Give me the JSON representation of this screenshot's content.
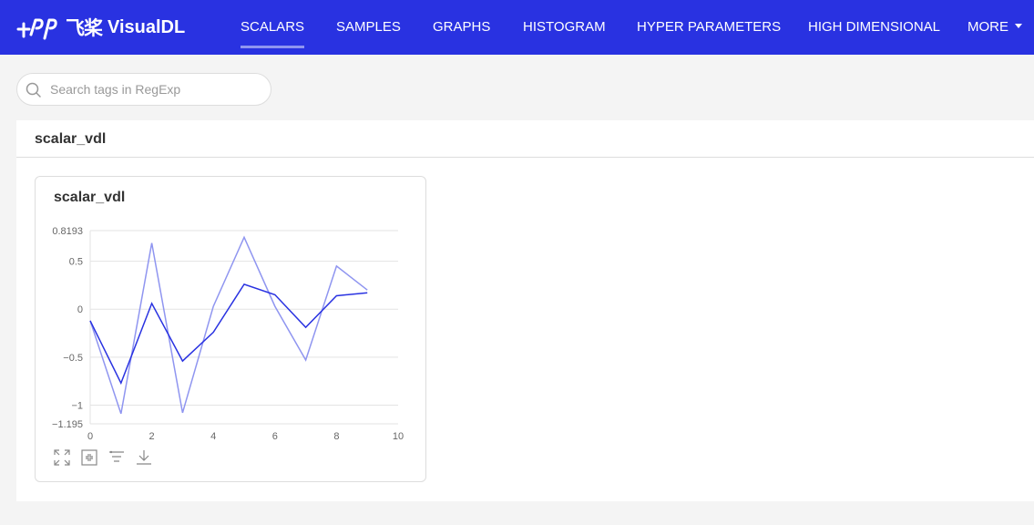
{
  "app": {
    "brand_cn": "飞桨",
    "brand_name": "VisualDL",
    "accent_color": "#2932e1"
  },
  "nav": {
    "items": [
      {
        "label": "SCALARS",
        "active": true
      },
      {
        "label": "SAMPLES"
      },
      {
        "label": "GRAPHS"
      },
      {
        "label": "HISTOGRAM"
      },
      {
        "label": "HYPER PARAMETERS"
      },
      {
        "label": "HIGH DIMENSIONAL"
      },
      {
        "label": "MORE"
      }
    ]
  },
  "search": {
    "placeholder": "Search tags in RegExp",
    "icon": "search-icon"
  },
  "group": {
    "title": "scalar_vdl"
  },
  "card": {
    "title": "scalar_vdl",
    "toolbar": [
      {
        "icon": "maximize-icon"
      },
      {
        "icon": "fit-screen-icon"
      },
      {
        "icon": "filter-icon"
      },
      {
        "icon": "download-icon"
      }
    ]
  },
  "chart_data": {
    "type": "line",
    "title": "scalar_vdl",
    "xlabel": "",
    "ylabel": "",
    "xlim": [
      0,
      10
    ],
    "ylim": [
      -1.195,
      0.8193
    ],
    "x_ticks": [
      0,
      2,
      4,
      6,
      8,
      10
    ],
    "y_ticks": [
      {
        "value": 0.8193,
        "label": "0.8193"
      },
      {
        "value": 0.5,
        "label": "0.5"
      },
      {
        "value": 0,
        "label": "0"
      },
      {
        "value": -0.5,
        "label": "−0.5"
      },
      {
        "value": -1,
        "label": "−1"
      },
      {
        "value": -1.195,
        "label": "−1.195"
      }
    ],
    "grid": true,
    "legend": "none",
    "series": [
      {
        "role": "raw",
        "color": "#8f95f0",
        "x": [
          0,
          1,
          2,
          3,
          4,
          5,
          6,
          7,
          8,
          9
        ],
        "y": [
          -0.12,
          -1.09,
          0.69,
          -1.08,
          0.03,
          0.75,
          0.03,
          -0.53,
          0.45,
          0.2
        ]
      },
      {
        "role": "smoothed",
        "color": "#2932e1",
        "x": [
          0,
          1,
          2,
          3,
          4,
          5,
          6,
          7,
          8,
          9
        ],
        "y": [
          -0.12,
          -0.77,
          0.06,
          -0.54,
          -0.24,
          0.26,
          0.15,
          -0.19,
          0.14,
          0.17
        ]
      }
    ]
  }
}
